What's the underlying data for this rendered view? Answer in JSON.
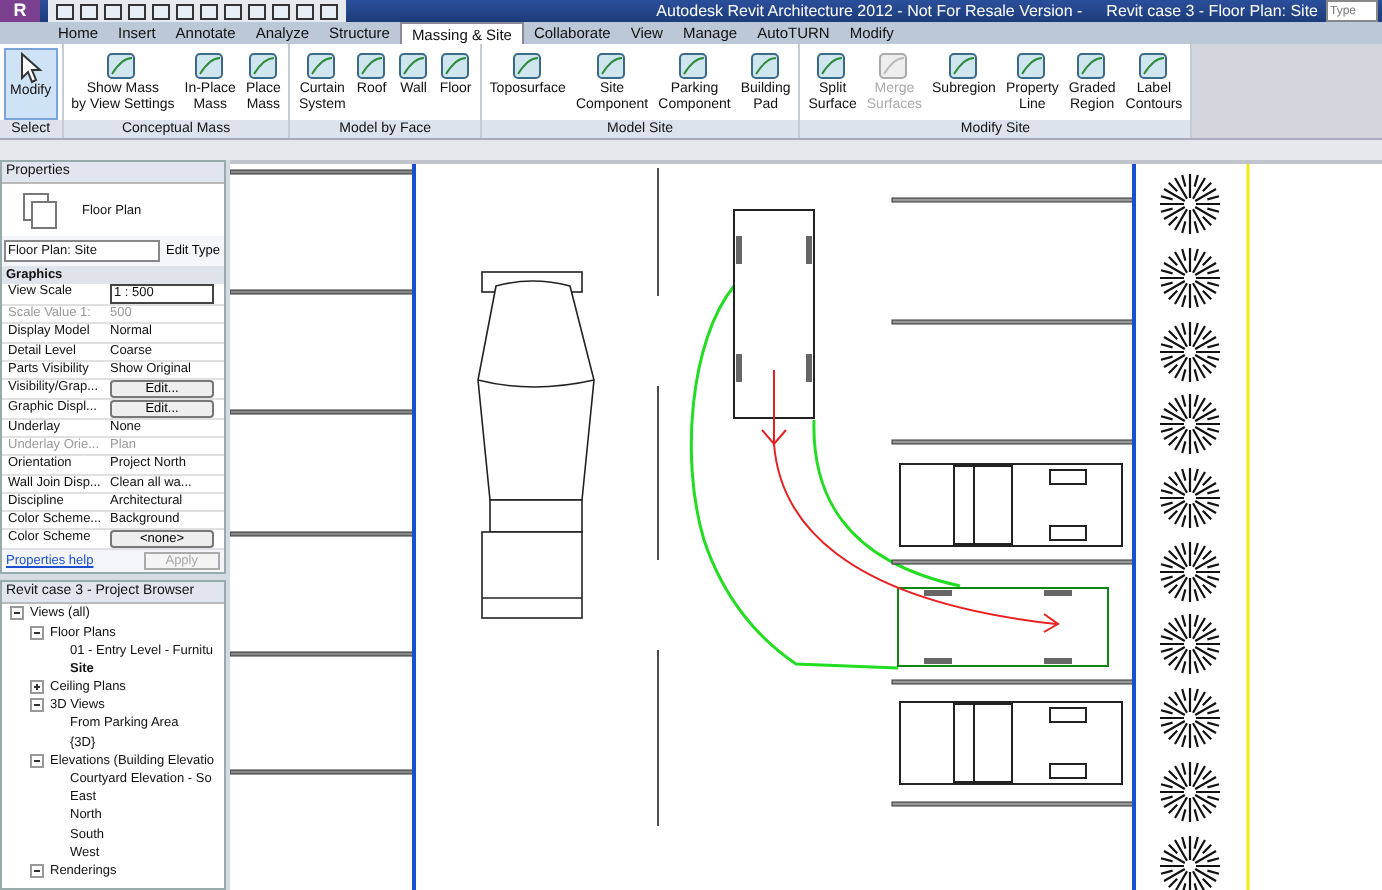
{
  "window": {
    "app_button": "R",
    "title": "Autodesk Revit Architecture 2012 - Not For Resale Version -",
    "document": "Revit case 3 - Floor Plan: Site",
    "search_placeholder": "Type"
  },
  "tabs": [
    {
      "label": "Home",
      "selected": false
    },
    {
      "label": "Insert",
      "selected": false
    },
    {
      "label": "Annotate",
      "selected": false
    },
    {
      "label": "Analyze",
      "selected": false
    },
    {
      "label": "Structure",
      "selected": false
    },
    {
      "label": "Massing & Site",
      "selected": true
    },
    {
      "label": "Collaborate",
      "selected": false
    },
    {
      "label": "View",
      "selected": false
    },
    {
      "label": "Manage",
      "selected": false
    },
    {
      "label": "AutoTURN",
      "selected": false
    },
    {
      "label": "Modify",
      "selected": false
    }
  ],
  "ribbon": [
    {
      "title": "Select",
      "buttons": [
        {
          "label": "Modify",
          "disabled": false,
          "selected": true
        }
      ]
    },
    {
      "title": "Conceptual Mass",
      "buttons": [
        {
          "label": "Show Mass\nby View Settings",
          "disabled": false,
          "selected": false
        },
        {
          "label": "In-Place\nMass",
          "disabled": false,
          "selected": false
        },
        {
          "label": "Place\nMass",
          "disabled": false,
          "selected": false
        }
      ]
    },
    {
      "title": "Model by Face",
      "buttons": [
        {
          "label": "Curtain\nSystem",
          "disabled": false,
          "selected": false
        },
        {
          "label": "Roof",
          "disabled": false,
          "selected": false
        },
        {
          "label": "Wall",
          "disabled": false,
          "selected": false
        },
        {
          "label": "Floor",
          "disabled": false,
          "selected": false
        }
      ]
    },
    {
      "title": "Model Site",
      "buttons": [
        {
          "label": "Toposurface",
          "disabled": false,
          "selected": false
        },
        {
          "label": "Site\nComponent",
          "disabled": false,
          "selected": false
        },
        {
          "label": "Parking\nComponent",
          "disabled": false,
          "selected": false
        },
        {
          "label": "Building\nPad",
          "disabled": false,
          "selected": false
        }
      ]
    },
    {
      "title": "Modify Site",
      "buttons": [
        {
          "label": "Split\nSurface",
          "disabled": false,
          "selected": false
        },
        {
          "label": "Merge\nSurfaces",
          "disabled": true,
          "selected": false
        },
        {
          "label": "Subregion",
          "disabled": false,
          "selected": false
        },
        {
          "label": "Property\nLine",
          "disabled": false,
          "selected": false
        },
        {
          "label": "Graded\nRegion",
          "disabled": false,
          "selected": false
        },
        {
          "label": "Label\nContours",
          "disabled": false,
          "selected": false
        }
      ]
    }
  ],
  "properties": {
    "title": "Properties",
    "type": "Floor Plan",
    "selector": "Floor Plan: Site",
    "edit_type": "Edit Type",
    "group": "Graphics",
    "rows": [
      {
        "name": "View Scale",
        "value": "1 : 500",
        "kind": "field",
        "disabled": false
      },
      {
        "name": "Scale Value    1:",
        "value": "500",
        "kind": "text",
        "disabled": true
      },
      {
        "name": "Display Model",
        "value": "Normal",
        "kind": "text",
        "disabled": false
      },
      {
        "name": "Detail Level",
        "value": "Coarse",
        "kind": "text",
        "disabled": false
      },
      {
        "name": "Parts Visibility",
        "value": "Show Original",
        "kind": "text",
        "disabled": false
      },
      {
        "name": "Visibility/Grap...",
        "value": "Edit...",
        "kind": "button",
        "disabled": false
      },
      {
        "name": "Graphic Displ...",
        "value": "Edit...",
        "kind": "button",
        "disabled": false
      },
      {
        "name": "Underlay",
        "value": "None",
        "kind": "text",
        "disabled": false
      },
      {
        "name": "Underlay Orie...",
        "value": "Plan",
        "kind": "text",
        "disabled": true
      },
      {
        "name": "Orientation",
        "value": "Project North",
        "kind": "text",
        "disabled": false
      },
      {
        "name": "Wall Join Disp...",
        "value": "Clean all wa...",
        "kind": "text",
        "disabled": false
      },
      {
        "name": "Discipline",
        "value": "Architectural",
        "kind": "text",
        "disabled": false
      },
      {
        "name": "Color Scheme...",
        "value": "Background",
        "kind": "text",
        "disabled": false
      },
      {
        "name": "Color Scheme",
        "value": "<none>",
        "kind": "button",
        "disabled": false
      }
    ],
    "help": "Properties help",
    "apply": {
      "label": "Apply",
      "disabled": true
    }
  },
  "browser": {
    "title": "Revit case 3 - Project Browser",
    "tree": [
      {
        "label": "Views (all)",
        "expanded": true,
        "selected": false,
        "children": [
          {
            "label": "Floor Plans",
            "expanded": true,
            "selected": false,
            "children": [
              {
                "label": "01 - Entry Level - Furnitu",
                "selected": false
              },
              {
                "label": "Site",
                "selected": true
              }
            ]
          },
          {
            "label": "Ceiling Plans",
            "expanded": false,
            "selected": false
          },
          {
            "label": "3D Views",
            "expanded": true,
            "selected": false,
            "children": [
              {
                "label": "From Parking Area",
                "selected": false
              },
              {
                "label": "{3D}",
                "selected": false
              }
            ]
          },
          {
            "label": "Elevations (Building Elevatio",
            "expanded": true,
            "selected": false,
            "children": [
              {
                "label": "Courtyard Elevation - So",
                "selected": false
              },
              {
                "label": "East",
                "selected": false
              },
              {
                "label": "North",
                "selected": false
              },
              {
                "label": "South",
                "selected": false
              },
              {
                "label": "West",
                "selected": false
              }
            ]
          },
          {
            "label": "Renderings",
            "expanded": true,
            "selected": false
          }
        ]
      }
    ]
  }
}
